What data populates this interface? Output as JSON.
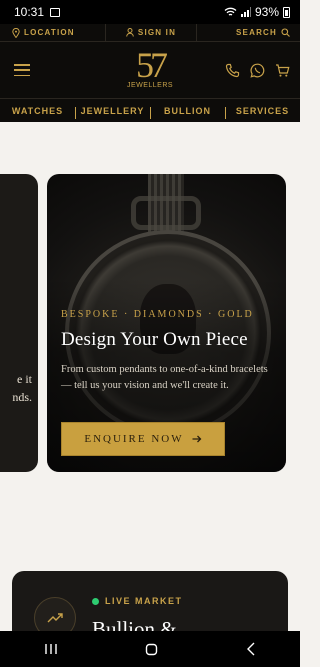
{
  "status": {
    "time": "10:31",
    "battery": "93%"
  },
  "utility": {
    "location": "LOCATION",
    "signin": "SIGN IN",
    "search": "SEARCH"
  },
  "logo": {
    "mark": "57",
    "name": "JEWELLERS"
  },
  "nav": [
    "WATCHES",
    "JEWELLERY",
    "BULLION",
    "SERVICES"
  ],
  "side_card": {
    "line1": "e it",
    "line2": "nds."
  },
  "hero": {
    "eyebrow": "BESPOKE · DIAMONDS · GOLD",
    "title": "Design Your Own Piece",
    "description": "From custom pendants to one-of-a-kind bracelets — tell us your vision and we'll create it.",
    "cta": "ENQUIRE NOW"
  },
  "market": {
    "live": "LIVE MARKET",
    "title": "Bullion &"
  },
  "colors": {
    "gold": "#c8a24a",
    "dark": "#0d0c0a",
    "cta": "#c9a03f",
    "live_dot": "#2ecc71",
    "page_bg": "#f4f2ee"
  },
  "icons": [
    "location-icon",
    "user-icon",
    "search-icon",
    "menu-icon",
    "phone-icon",
    "whatsapp-icon",
    "cart-icon",
    "arrow-right-icon",
    "trending-up-icon"
  ]
}
